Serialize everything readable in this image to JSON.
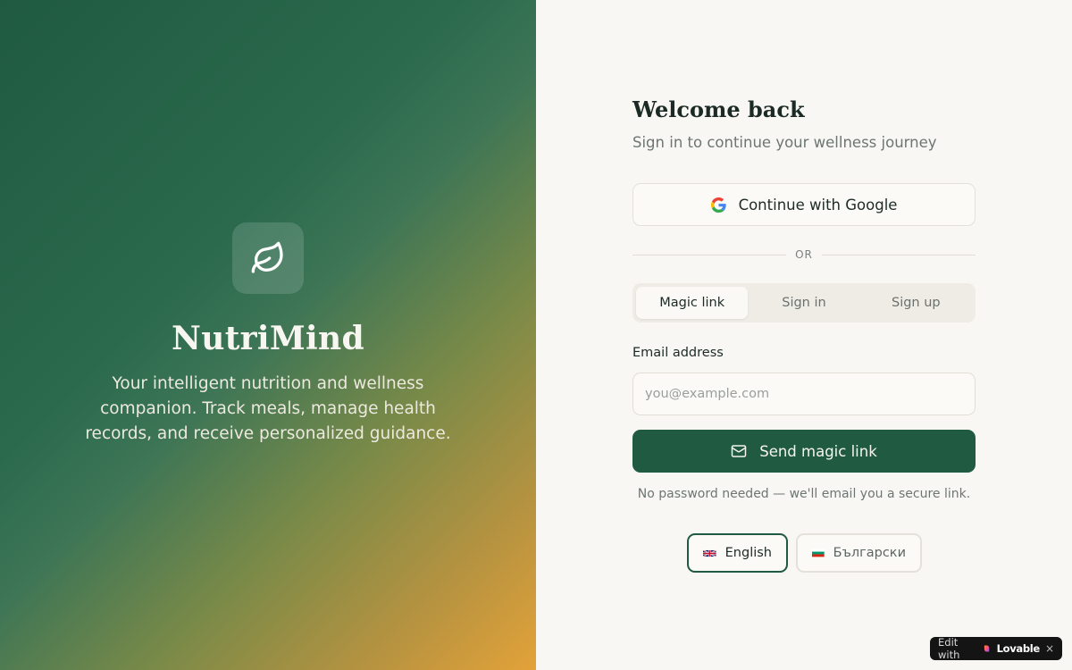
{
  "hero": {
    "brand": "NutriMind",
    "tagline": "Your intelligent nutrition and wellness companion. Track meals, manage health records, and receive personalized guidance.",
    "logo_icon": "leaf-icon"
  },
  "auth": {
    "title": "Welcome back",
    "subtitle": "Sign in to continue your wellness journey",
    "google_label": "Continue with Google",
    "divider_text": "OR",
    "tabs": [
      {
        "label": "Magic link",
        "active": true
      },
      {
        "label": "Sign in",
        "active": false
      },
      {
        "label": "Sign up",
        "active": false
      }
    ],
    "email_label": "Email address",
    "email_placeholder": "you@example.com",
    "email_value": "",
    "send_label": "Send magic link",
    "hint": "No password needed — we'll email you a secure link."
  },
  "languages": [
    {
      "label": "English",
      "flag": "uk-flag-icon",
      "active": true
    },
    {
      "label": "Български",
      "flag": "bulgaria-flag-icon",
      "active": false
    }
  ],
  "badge": {
    "prefix": "Edit with",
    "brand": "Lovable",
    "close": "×"
  },
  "colors": {
    "primary": "#1f5a41",
    "gradient_end": "#e3a239",
    "background": "#f9f7f4"
  }
}
